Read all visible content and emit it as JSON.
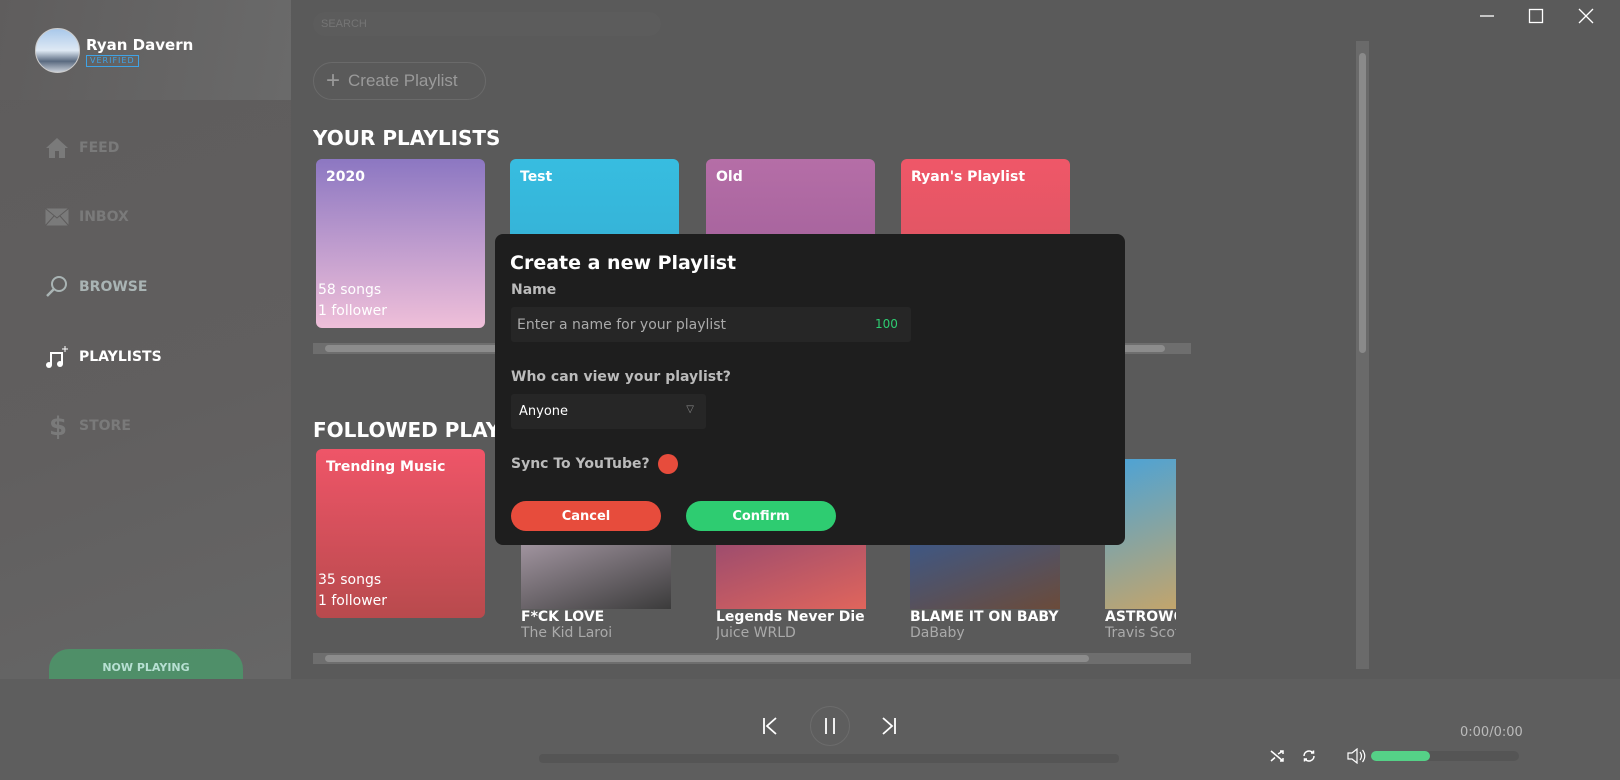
{
  "user": {
    "name": "Ryan Davern",
    "badge": "VERIFIED"
  },
  "nav": [
    {
      "label": "FEED",
      "icon": "home-icon",
      "color": "#7a7a7a"
    },
    {
      "label": "INBOX",
      "icon": "mail-icon",
      "color": "#7a7a7a"
    },
    {
      "label": "BROWSE",
      "icon": "search-icon",
      "color": "#a9b4b4"
    },
    {
      "label": "PLAYLISTS",
      "icon": "music-note-plus-icon",
      "color": "#ffffff"
    },
    {
      "label": "STORE",
      "icon": "dollar-icon",
      "color": "#7a7a7a"
    }
  ],
  "now_playing": "NOW PLAYING",
  "search": {
    "placeholder": "SEARCH"
  },
  "create_playlist": "Create Playlist",
  "your_playlists": {
    "title": "YOUR PLAYLISTS",
    "items": [
      {
        "name": "2020",
        "songs": "58 songs",
        "followers": "1 follower",
        "colors": [
          "#8c77c2",
          "#efbfd9"
        ]
      },
      {
        "name": "Test",
        "colors": [
          "#37bde0",
          "#34a9cf"
        ]
      },
      {
        "name": "Old",
        "colors": [
          "#b56ea7",
          "#9a5a94"
        ]
      },
      {
        "name": "Ryan's Playlist",
        "colors": [
          "#ef5768",
          "#d35560"
        ]
      }
    ]
  },
  "followed": {
    "title": "FOLLOWED PLAYLISTS",
    "playlist": {
      "name": "Trending Music",
      "songs": "35 songs",
      "followers": "1 follower",
      "colors": [
        "#ef5568",
        "#b84a4d"
      ]
    },
    "albums": [
      {
        "title": "F*CK LOVE",
        "artist": "The Kid Laroi",
        "colors": [
          "#e9d3e6",
          "#3b3b3b"
        ]
      },
      {
        "title": "Legends Never Die",
        "artist": "Juice WRLD",
        "colors": [
          "#6e3b7a",
          "#e0655c"
        ]
      },
      {
        "title": "BLAME IT ON BABY",
        "artist": "DaBaby",
        "colors": [
          "#1f60b8",
          "#6b4b3a"
        ]
      },
      {
        "title": "ASTROWORLD",
        "artist": "Travis Scott",
        "colors": [
          "#4aa3d8",
          "#d6a55a"
        ]
      }
    ]
  },
  "modal": {
    "title": "Create a new Playlist",
    "name_label": "Name",
    "name_placeholder": "Enter a name for your playlist",
    "name_counter": "100",
    "visibility_label": "Who can view your playlist?",
    "visibility_value": "Anyone",
    "sync_label": "Sync To YouTube?",
    "sync_on": false,
    "cancel": "Cancel",
    "confirm": "Confirm",
    "cancel_color": "#e74c3c",
    "confirm_color": "#2ecc71"
  },
  "player": {
    "time": "0:00/0:00",
    "progress": 0,
    "volume": 0.4
  }
}
